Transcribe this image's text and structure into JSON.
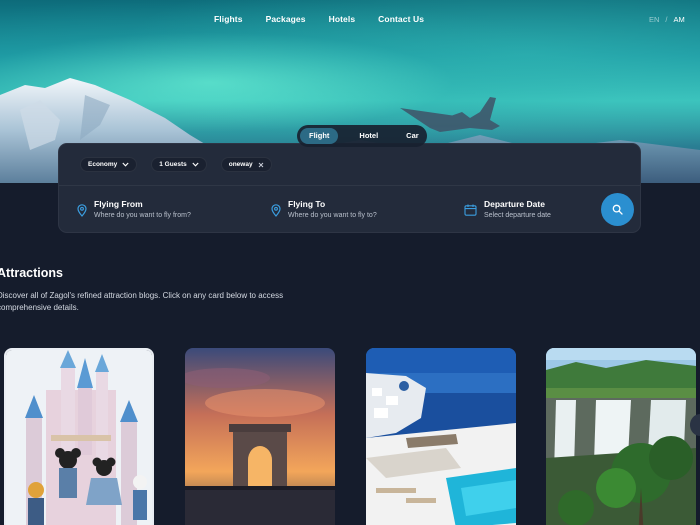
{
  "nav": {
    "items": [
      {
        "label": "Flights"
      },
      {
        "label": "Packages"
      },
      {
        "label": "Hotels"
      },
      {
        "label": "Contact Us"
      }
    ]
  },
  "lang": {
    "en": "EN",
    "separator": "/",
    "am": "AM"
  },
  "tabs": [
    {
      "label": "Flight",
      "active": true
    },
    {
      "label": "Hotel"
    },
    {
      "label": "Car"
    }
  ],
  "filters": {
    "class": "Economy",
    "guests": "1 Guests",
    "trip": "oneway"
  },
  "fields": {
    "from": {
      "title": "Flying From",
      "placeholder": "Where do you want to fly from?",
      "icon": "location-pin-icon"
    },
    "to": {
      "title": "Flying To",
      "placeholder": "Where do you want to fly to?",
      "icon": "location-pin-icon"
    },
    "date": {
      "title": "Departure Date",
      "placeholder": "Select departure date",
      "icon": "calendar-icon"
    }
  },
  "search_button": {
    "icon": "search-icon",
    "color": "#2b8fd0"
  },
  "attractions": {
    "title": "Attractions",
    "description": "Discover all of Zagol's refined attraction blogs. Click on any card below to access comprehensive details.",
    "cards": [
      {
        "image": "castle-with-mascots"
      },
      {
        "image": "triumphal-arch-sunset"
      },
      {
        "image": "white-village-seaside-pool"
      },
      {
        "image": "waterfall-tropical-trees"
      }
    ]
  },
  "colors": {
    "background": "#151c2c",
    "card": "#232b3b",
    "accent": "#2b8fd0"
  }
}
